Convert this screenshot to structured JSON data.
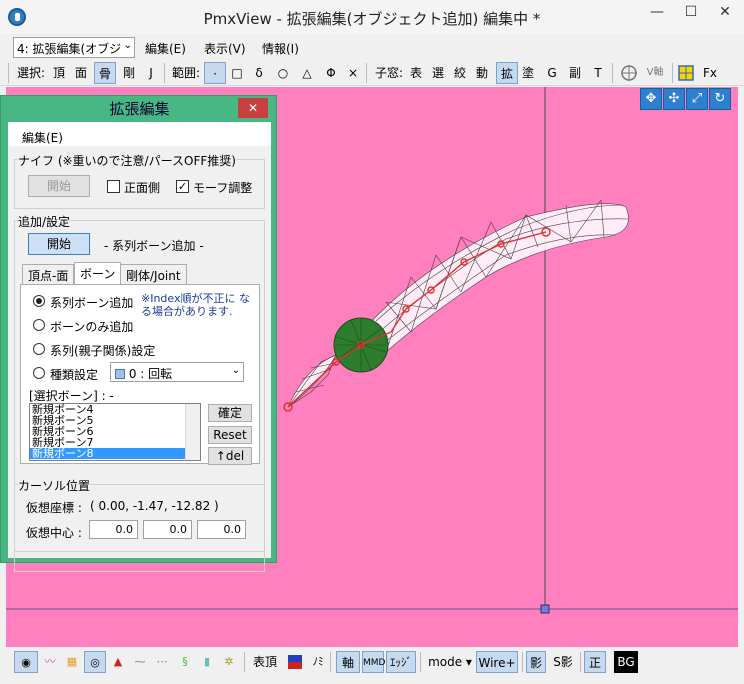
{
  "window": {
    "title": "PmxView - 拡張編集(オブジェクト追加) 編集中 *",
    "minimize": "—",
    "maximize": "☐",
    "close": "✕"
  },
  "menubar": {
    "mode": "4: 拡張編集(オブジ",
    "items": [
      "編集(E)",
      "表示(V)",
      "情報(I)"
    ]
  },
  "toolbar": {
    "select_label": "選択:",
    "select_items": [
      "頂",
      "面",
      "骨",
      "剛",
      "J"
    ],
    "select_active": "骨",
    "range_label": "範囲:",
    "range_items": [
      "·",
      "□",
      "δ",
      "○",
      "△",
      "Φ",
      "×"
    ],
    "child_label": "子窓:",
    "child_items": [
      "表",
      "選",
      "絞",
      "動",
      "拡",
      "塗",
      "G",
      "副",
      "T"
    ],
    "child_active": "拡",
    "axis_label": "V軸",
    "fx_label": "Fx"
  },
  "dialog": {
    "title": "拡張編集",
    "close": "✕",
    "menu": "編集(E)",
    "knife": {
      "label": "ナイフ (※重いので注意/パースOFF推奨)",
      "start": "開始",
      "front_label": "正面側",
      "front_checked": false,
      "morph_label": "モーフ調整",
      "morph_checked": true
    },
    "add": {
      "label": "追加/設定",
      "start": "開始",
      "mode_text": "- 系列ボーン追加 -"
    },
    "tabs": [
      "頂点-面",
      "ボーン",
      "剛体/Joint"
    ],
    "active_tab": "ボーン",
    "options": [
      "系列ボーン追加",
      "ボーンのみ追加",
      "系列(親子関係)設定",
      "種類設定"
    ],
    "selected_option": 0,
    "note": "※Index順が不正に なる場合があります.",
    "type_combo": "0 : 回転",
    "selected_bones_label": "[選択ボーン] : -",
    "bones": [
      "新規ボーン4",
      "新規ボーン5",
      "新規ボーン6",
      "新規ボーン7",
      "新規ボーン8"
    ],
    "selected_bone": 4,
    "confirm": "確定",
    "reset": "Reset",
    "del": "↑del",
    "cursor": {
      "label": "カーソル位置",
      "virtual_coord_label": "仮想座標 :",
      "virtual_coord": "( 0.00, -1.47, -12.82 )",
      "virtual_center_label": "仮想中心 :",
      "center_values": [
        "0.0",
        "0.0",
        "0.0"
      ]
    }
  },
  "bottombar": {
    "items": [
      "表頂",
      "ﾉﾐ",
      "軸",
      "MMD",
      "ｴｯｼﾞ",
      "mode ▾",
      "Wire+",
      "影",
      "S影",
      "正",
      "BG"
    ]
  },
  "colors": {
    "viewport": "#ff7fbf",
    "dialog": "#47b883",
    "active": "#c5d9ef"
  }
}
